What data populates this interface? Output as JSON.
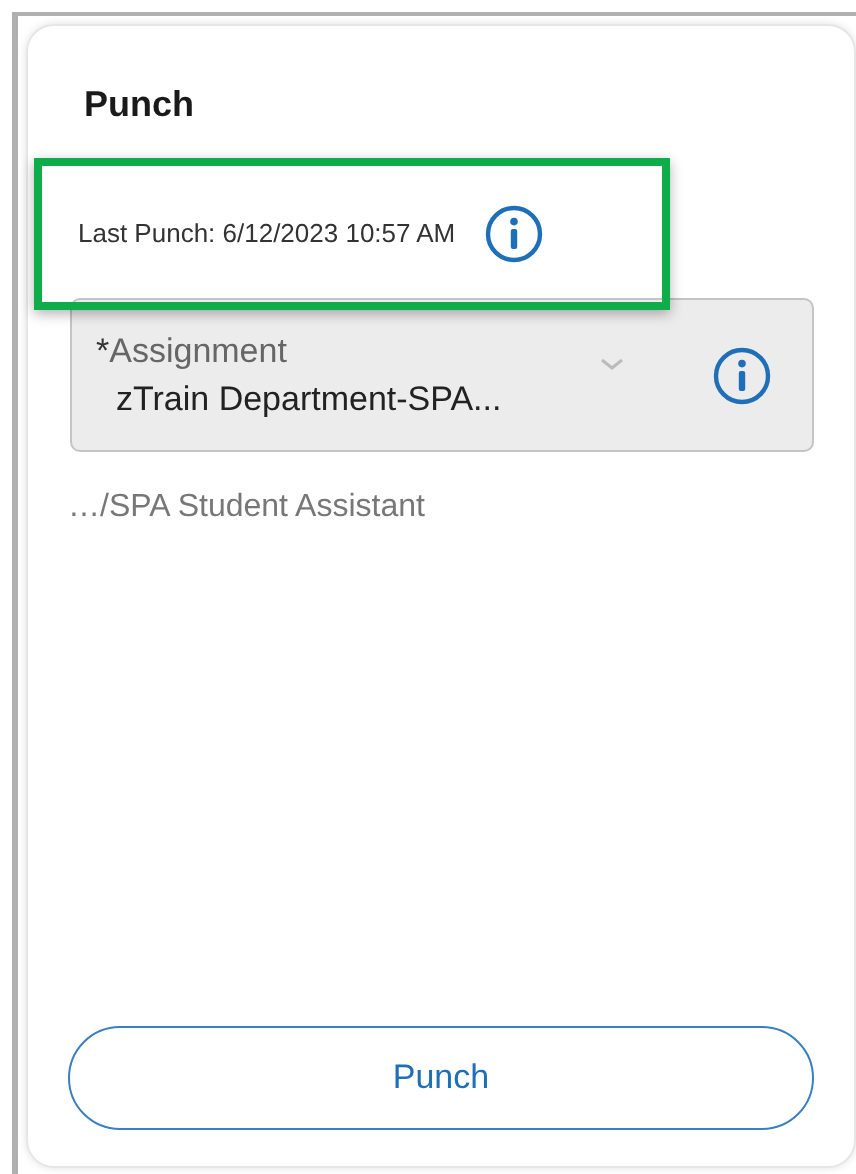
{
  "card": {
    "title": "Punch"
  },
  "last_punch": {
    "text": "Last Punch: 6/12/2023 10:57 AM",
    "highlighted": true
  },
  "assignment": {
    "required_mark": "*",
    "label": "Assignment",
    "value": "zTrain Department-SPA...",
    "disabled": true
  },
  "assignment_path": "…/SPA Student Assistant",
  "buttons": [
    {
      "label": "Punch"
    }
  ]
}
